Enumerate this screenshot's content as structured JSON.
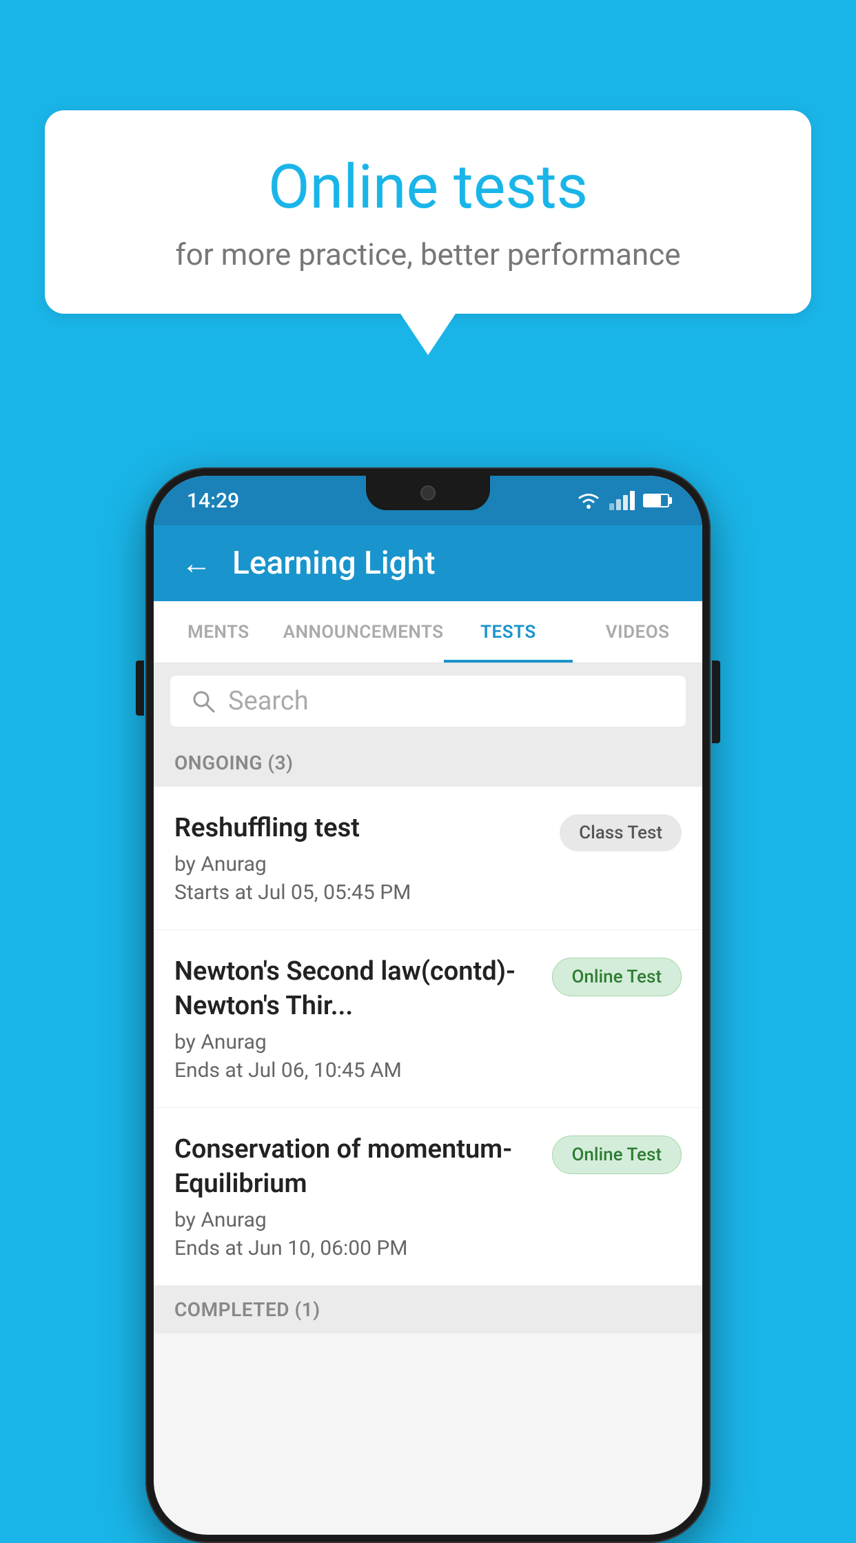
{
  "background_color": "#1ab5e8",
  "speech_bubble": {
    "title": "Online tests",
    "subtitle": "for more practice, better performance"
  },
  "status_bar": {
    "time": "14:29",
    "wifi_icon": "wifi",
    "signal_icon": "signal",
    "battery_icon": "battery"
  },
  "app_header": {
    "back_label": "←",
    "title": "Learning Light"
  },
  "tabs": [
    {
      "label": "MENTS",
      "active": false
    },
    {
      "label": "ANNOUNCEMENTS",
      "active": false
    },
    {
      "label": "TESTS",
      "active": true
    },
    {
      "label": "VIDEOS",
      "active": false
    }
  ],
  "search": {
    "placeholder": "Search"
  },
  "ongoing_section": {
    "label": "ONGOING (3)"
  },
  "tests": [
    {
      "name": "Reshuffling test",
      "author": "by Anurag",
      "date_label": "Starts at",
      "date": "Jul 05, 05:45 PM",
      "badge": "Class Test",
      "badge_type": "class"
    },
    {
      "name": "Newton's Second law(contd)-Newton's Thir...",
      "author": "by Anurag",
      "date_label": "Ends at",
      "date": "Jul 06, 10:45 AM",
      "badge": "Online Test",
      "badge_type": "online"
    },
    {
      "name": "Conservation of momentum-Equilibrium",
      "author": "by Anurag",
      "date_label": "Ends at",
      "date": "Jun 10, 06:00 PM",
      "badge": "Online Test",
      "badge_type": "online"
    }
  ],
  "completed_section": {
    "label": "COMPLETED (1)"
  }
}
